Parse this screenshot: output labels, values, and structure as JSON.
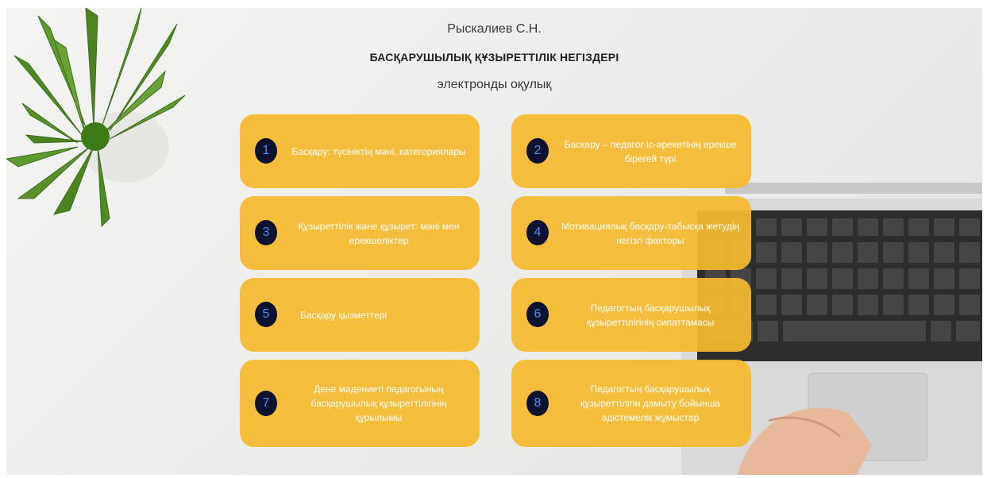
{
  "header": {
    "author": "Рыскалиев С.Н.",
    "title": "БАСҚАРУШЫЛЫҚ ҚҰЗЫРЕТТІЛІК НЕГІЗДЕРІ",
    "subtitle": "электронды оқулық"
  },
  "cards": [
    {
      "number": "1",
      "label": "Басқару: түсініктің мәні, категориялары"
    },
    {
      "number": "2",
      "label": "Басқару – педагог іс-әрекетінің ерекше бірегей түрі"
    },
    {
      "number": "3",
      "label": "Құзыреттілік және құзырет: мәні мен ерекшеліктер"
    },
    {
      "number": "4",
      "label": "Мотивациялық басқару-табысқа жетудің негізгі факторы"
    },
    {
      "number": "5",
      "label": "Басқару қызметтері"
    },
    {
      "number": "6",
      "label": "Педагогтың басқарушылық құзыреттілігінің сипаттамасы"
    },
    {
      "number": "7",
      "label": "Дене мәдениеті педагогының басқарушылық құзыреттілігінің құрылымы"
    },
    {
      "number": "8",
      "label": "Педагогтың басқарушылық құзыреттілігін дамыту бойынша әдістемелік жұмыстар"
    }
  ],
  "colors": {
    "card": "#f4ba2e",
    "badge": "#0c1230",
    "badge_number": "#4a8fe8",
    "background": "#eeeeec"
  },
  "icons": {
    "plant": "plant-icon",
    "laptop": "laptop-icon"
  }
}
